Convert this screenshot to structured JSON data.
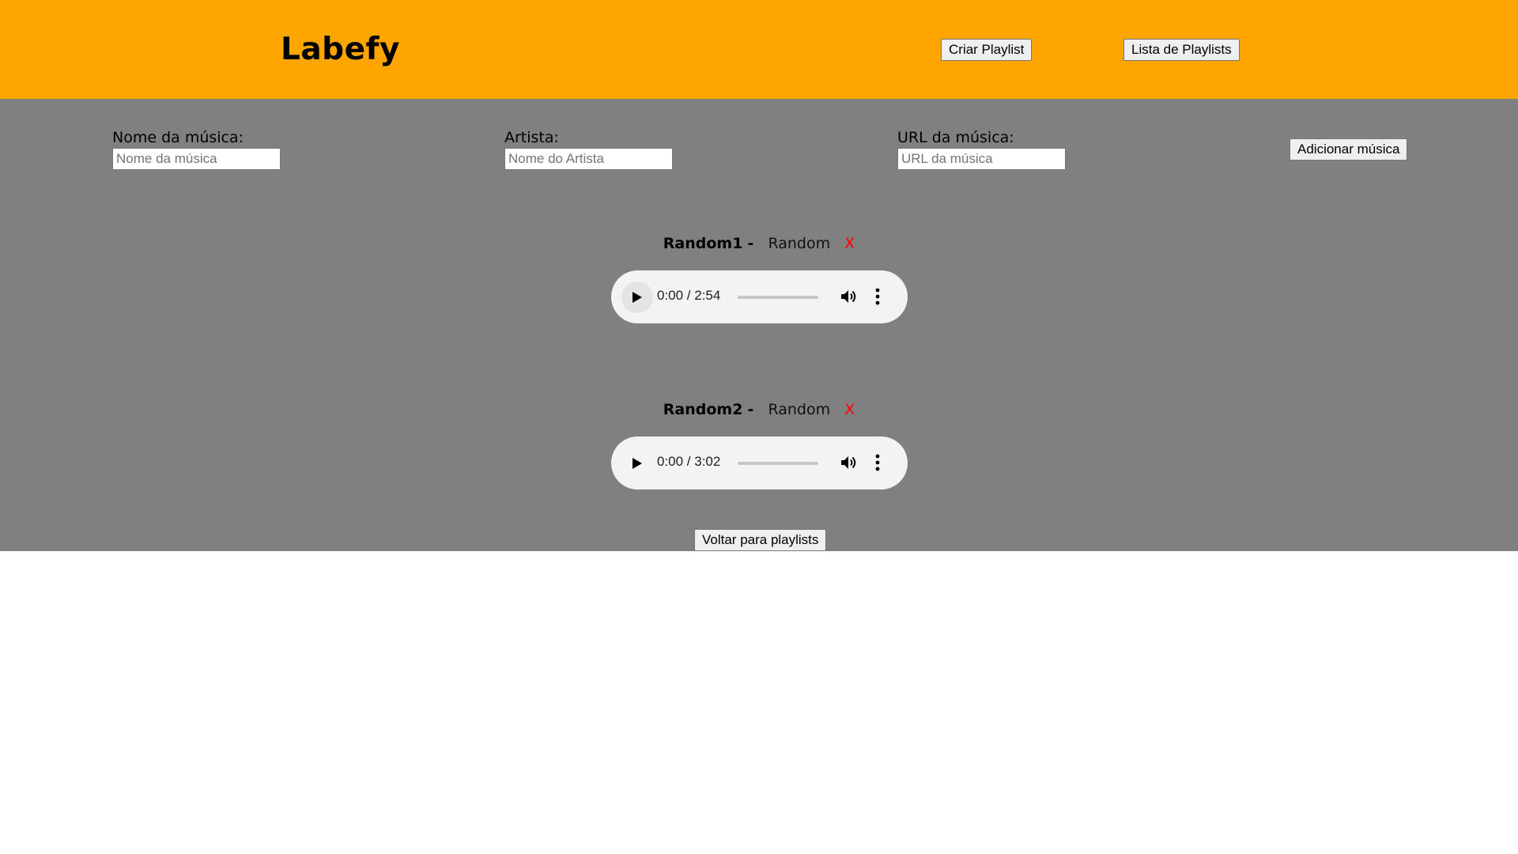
{
  "app": {
    "logo": "Labefy"
  },
  "header": {
    "create_playlist_label": "Criar Playlist",
    "playlist_list_label": "Lista de Playlists"
  },
  "form": {
    "name": {
      "label": "Nome da música:",
      "placeholder": "Nome da música",
      "value": ""
    },
    "artist": {
      "label": "Artista:",
      "placeholder": "Nome do Artista",
      "value": ""
    },
    "url": {
      "label": "URL da música:",
      "placeholder": "URL da música",
      "value": ""
    },
    "add_label": "Adicionar música"
  },
  "tracks": [
    {
      "name": "Random1",
      "separator": "-",
      "artist": "Random",
      "remove": "X",
      "time": "0:00 / 2:54",
      "progress": 0,
      "icons": [
        "play-icon",
        "volume-icon",
        "more-vert-icon"
      ]
    },
    {
      "name": "Random2",
      "separator": "-",
      "artist": "Random",
      "remove": "X",
      "time": "0:00 / 3:02",
      "progress": 0,
      "icons": [
        "play-icon",
        "volume-icon",
        "more-vert-icon"
      ]
    }
  ],
  "footer": {
    "back_label": "Voltar para playlists"
  },
  "colors": {
    "header_bg": "#ffa500",
    "main_bg": "#808080",
    "remove": "#ff0000",
    "player_bg": "#f1f3f4"
  }
}
